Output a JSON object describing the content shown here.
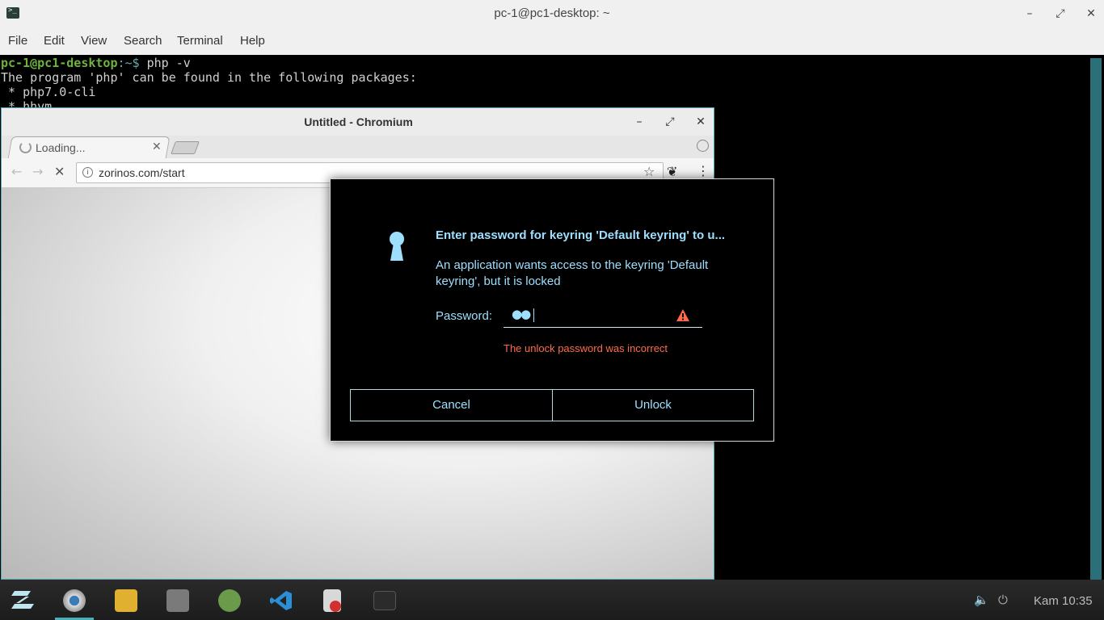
{
  "terminal": {
    "title": "pc-1@pc1-desktop: ~",
    "controls": {
      "minimize": "–",
      "maximize": "⤢",
      "close": "✕"
    },
    "menu": [
      "File",
      "Edit",
      "View",
      "Search",
      "Terminal",
      "Help"
    ],
    "lines": {
      "prompt_user": "pc-1@pc1-desktop",
      "prompt_path": ":~$",
      "command": " php -v",
      "line2": "The program 'php' can be found in the following packages:",
      "line3": " * php7.0-cli",
      "line4": " * hhvm"
    }
  },
  "chromium": {
    "title": "Untitled - Chromium",
    "controls": {
      "minimize": "–",
      "maximize": "⤢",
      "close": "✕"
    },
    "tab_label": "Loading...",
    "tab_close": "✕",
    "url": "zorinos.com/start",
    "info_icon": "i",
    "star_icon": "☆",
    "menu_icon": "⋮"
  },
  "dialog": {
    "heading": "Enter password for keyring 'Default keyring' to u...",
    "message": "An application wants access to the keyring 'Default keyring', but it is locked",
    "password_label": "Password:",
    "password_mask": "●●",
    "error": "The unlock password was incorrect",
    "cancel_label": "Cancel",
    "unlock_label": "Unlock",
    "accent_color": "#9edfff",
    "error_color": "#ff6b4a"
  },
  "taskbar": {
    "clock": "Kam 10:35",
    "apps": [
      "zorin-menu-icon",
      "chromium-icon",
      "mail-icon",
      "files-icon",
      "android-studio-icon",
      "vscode-icon",
      "screen-recorder-icon",
      "terminal-icon"
    ],
    "tray": [
      "volume-icon",
      "power-icon"
    ]
  }
}
